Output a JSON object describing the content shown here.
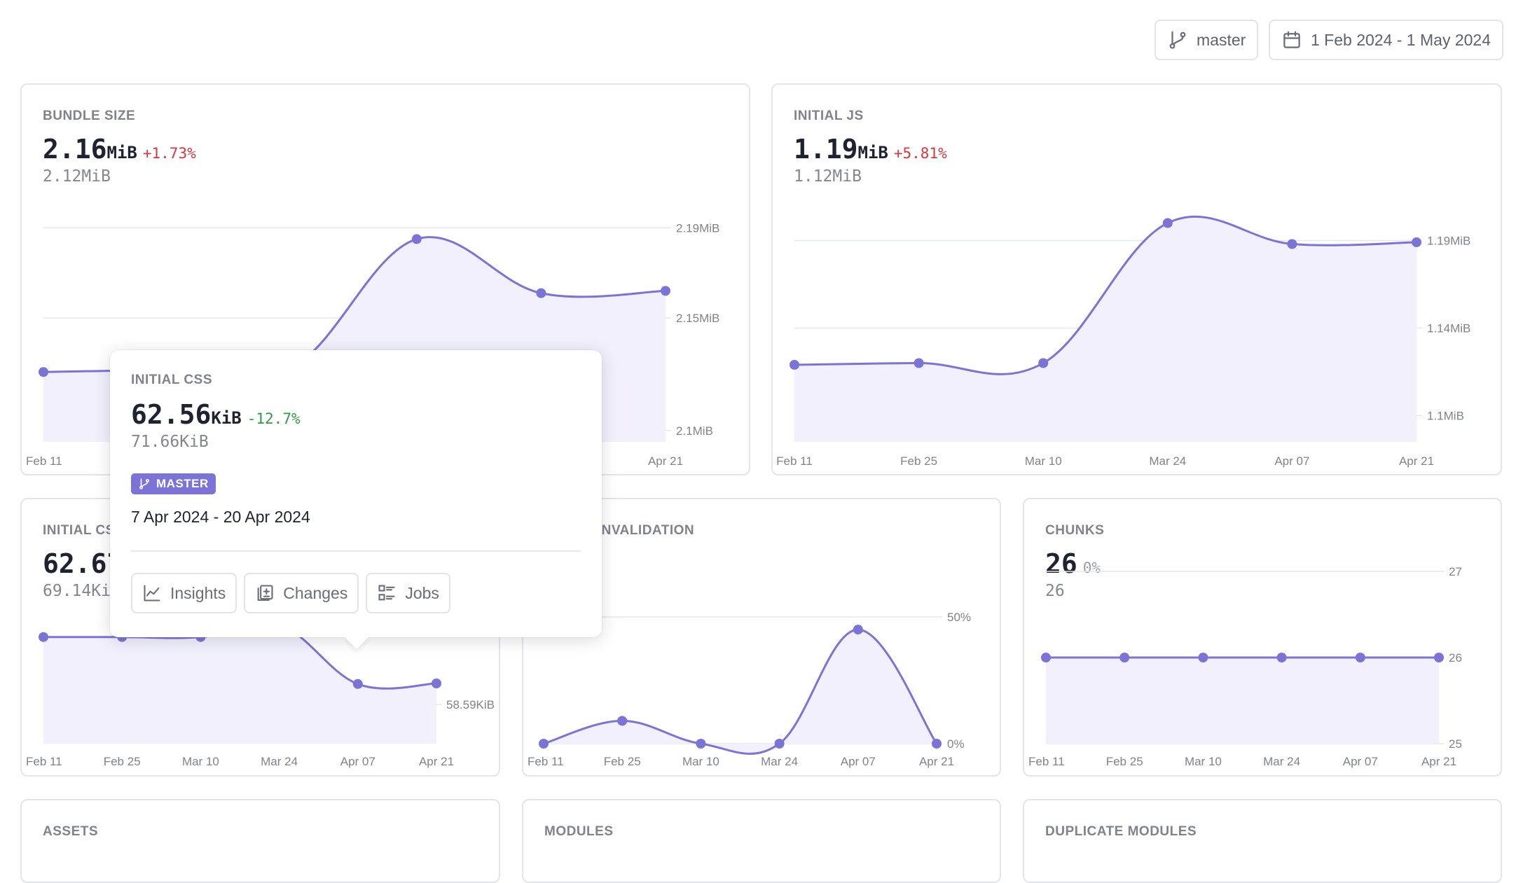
{
  "toolbar": {
    "branch_label": "master",
    "date_range_label": "1 Feb 2024 - 1 May 2024"
  },
  "cards": {
    "bundle_size": {
      "title": "BUNDLE SIZE",
      "value": "2.16",
      "unit": "MiB",
      "delta": "+1.73%",
      "previous": "2.12MiB"
    },
    "initial_js": {
      "title": "INITIAL JS",
      "value": "1.19",
      "unit": "MiB",
      "delta": "+5.81%",
      "previous": "1.12MiB"
    },
    "initial_css": {
      "title": "INITIAL CSS",
      "value": "62.67",
      "unit": "KiB",
      "previous": "69.14KiB"
    },
    "cache_invalidation": {
      "title": "CACHE INVALIDATION"
    },
    "chunks": {
      "title": "CHUNKS",
      "value": "26",
      "delta": "0%",
      "previous": "26"
    },
    "assets": {
      "title": "ASSETS"
    },
    "modules": {
      "title": "MODULES"
    },
    "duplicate_modules": {
      "title": "DUPLICATE MODULES"
    }
  },
  "tooltip": {
    "title": "INITIAL CSS",
    "value": "62.56",
    "unit": "KiB",
    "delta": "-12.7%",
    "previous": "71.66KiB",
    "badge": "MASTER",
    "date_range": "7 Apr 2024 - 20 Apr 2024",
    "actions": {
      "insights": "Insights",
      "changes": "Changes",
      "jobs": "Jobs"
    }
  },
  "colors": {
    "accent": "#7b74d6",
    "area_fill": "#f1f0fc",
    "increase": "#d9363e",
    "decrease": "#2f9b43"
  },
  "chart_data": [
    {
      "id": "bundle_size",
      "type": "area",
      "x": [
        "Feb 11",
        "Feb 25",
        "Mar 10",
        "Mar 24",
        "Apr 07",
        "Apr 21"
      ],
      "series": [
        {
          "values": [
            2.126,
            2.127,
            2.128,
            2.185,
            2.161,
            2.162
          ]
        }
      ],
      "yticks": [
        "2.19MiB",
        "2.15MiB",
        "2.1MiB"
      ],
      "ytick_values": [
        2.19,
        2.15,
        2.1
      ],
      "ylim": [
        2.095,
        2.196
      ],
      "grid": true
    },
    {
      "id": "initial_js",
      "type": "area",
      "x": [
        "Feb 11",
        "Feb 25",
        "Mar 10",
        "Mar 24",
        "Apr 07",
        "Apr 21"
      ],
      "series": [
        {
          "values": [
            1.119,
            1.12,
            1.12,
            1.2,
            1.188,
            1.189
          ]
        }
      ],
      "yticks": [
        "1.19MiB",
        "1.14MiB",
        "1.1MiB"
      ],
      "ytick_values": [
        1.19,
        1.14,
        1.09
      ],
      "ylim": [
        1.075,
        1.205
      ],
      "grid": true
    },
    {
      "id": "initial_css",
      "type": "area",
      "x": [
        "Feb 11",
        "Feb 25",
        "Mar 10",
        "Mar 24",
        "Apr 07",
        "Apr 21"
      ],
      "series": [
        {
          "values": [
            71.66,
            71.66,
            71.66,
            74.0,
            62.56,
            62.67
          ]
        }
      ],
      "yticks": [
        "58.59KiB"
      ],
      "ytick_values": [
        58.59
      ],
      "ylim": [
        51.0,
        78.0
      ],
      "grid": true
    },
    {
      "id": "cache_invalidation",
      "type": "area",
      "x": [
        "Feb 11",
        "Feb 25",
        "Mar 10",
        "Mar 24",
        "Apr 07",
        "Apr 21"
      ],
      "series": [
        {
          "values": [
            0,
            9,
            0,
            0,
            45,
            0
          ]
        }
      ],
      "yticks": [
        "50%",
        "0%"
      ],
      "ytick_values": [
        50,
        0
      ],
      "ylim": [
        0,
        50
      ],
      "grid": true
    },
    {
      "id": "chunks",
      "type": "area",
      "x": [
        "Feb 11",
        "Feb 25",
        "Mar 10",
        "Mar 24",
        "Apr 07",
        "Apr 21"
      ],
      "series": [
        {
          "values": [
            26,
            26,
            26,
            26,
            26,
            26
          ]
        }
      ],
      "yticks": [
        "27",
        "26",
        "25"
      ],
      "ytick_values": [
        27,
        26,
        25
      ],
      "ylim": [
        25,
        27
      ],
      "grid": true
    }
  ]
}
